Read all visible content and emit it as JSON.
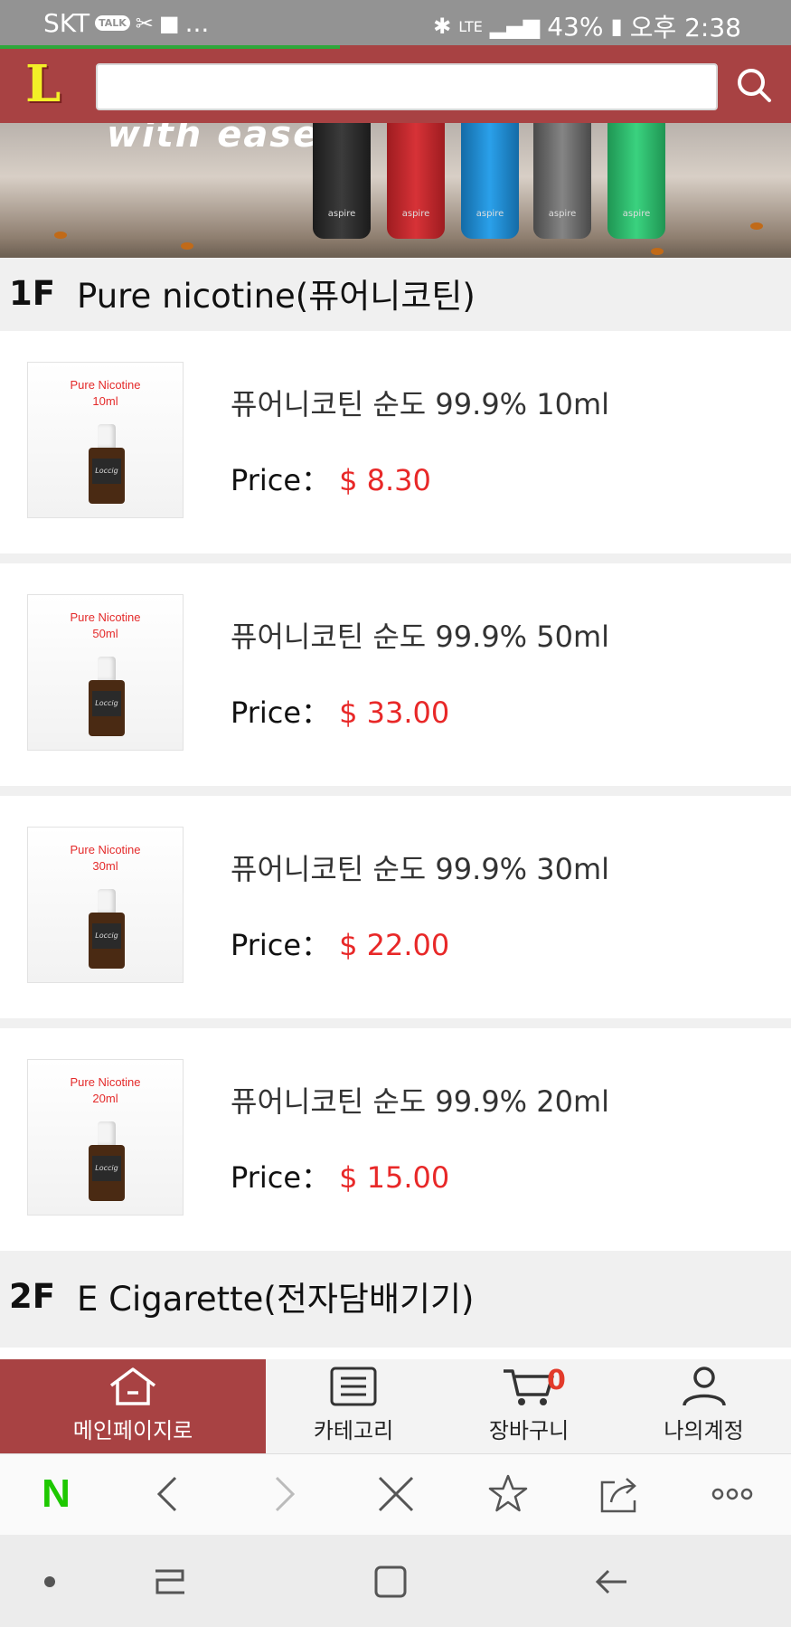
{
  "status_bar": {
    "carrier": "SKT",
    "talk_badge": "TALK",
    "more": "...",
    "network": "LTE",
    "battery": "43%",
    "time": "오후 2:38"
  },
  "header": {
    "logo": "L",
    "search": {
      "value": "",
      "placeholder": ""
    }
  },
  "banner": {
    "text": "with ease",
    "device_brand": "aspire",
    "device_colors": [
      "#2a2a2a",
      "#c8262a",
      "#1f8fd6",
      "#6d6d6d",
      "#2fbf6d"
    ]
  },
  "sections": [
    {
      "floor": "1F",
      "title": "Pure nicotine(퓨어니코틴)"
    },
    {
      "floor": "2F",
      "title": "E Cigarette(전자담배기기)"
    }
  ],
  "products": [
    {
      "thumb_line1": "Pure Nicotine",
      "thumb_line2": "10ml",
      "name": "퓨어니코틴 순도 99.9% 10ml",
      "price_label": "Price：",
      "price": "$ 8.30"
    },
    {
      "thumb_line1": "Pure Nicotine",
      "thumb_line2": "50ml",
      "name": "퓨어니코틴 순도 99.9% 50ml",
      "price_label": "Price：",
      "price": "$ 33.00"
    },
    {
      "thumb_line1": "Pure Nicotine",
      "thumb_line2": "30ml",
      "name": "퓨어니코틴 순도 99.9% 30ml",
      "price_label": "Price：",
      "price": "$ 22.00"
    },
    {
      "thumb_line1": "Pure Nicotine",
      "thumb_line2": "20ml",
      "name": "퓨어니코틴 순도 99.9% 20ml",
      "price_label": "Price：",
      "price": "$ 15.00"
    }
  ],
  "bottle_label": "Loccig",
  "tabs": [
    {
      "label": "메인페이지로",
      "icon": "home-icon"
    },
    {
      "label": "카테고리",
      "icon": "list-icon"
    },
    {
      "label": "장바구니",
      "icon": "cart-icon",
      "badge": "0"
    },
    {
      "label": "나의계정",
      "icon": "user-icon"
    }
  ],
  "browser_bar": {
    "icons": [
      "naver-icon",
      "back-icon",
      "forward-icon",
      "close-icon",
      "bookmark-icon",
      "share-icon",
      "more-icon"
    ],
    "naver_letter": "N"
  },
  "system_nav": {
    "icons": [
      "dot-icon",
      "recents-icon",
      "home-square-icon",
      "back-arrow-icon"
    ]
  },
  "colors": {
    "brand": "#a84243",
    "price": "#e82828",
    "logo": "#f3ef27",
    "naver": "#1ec800"
  }
}
